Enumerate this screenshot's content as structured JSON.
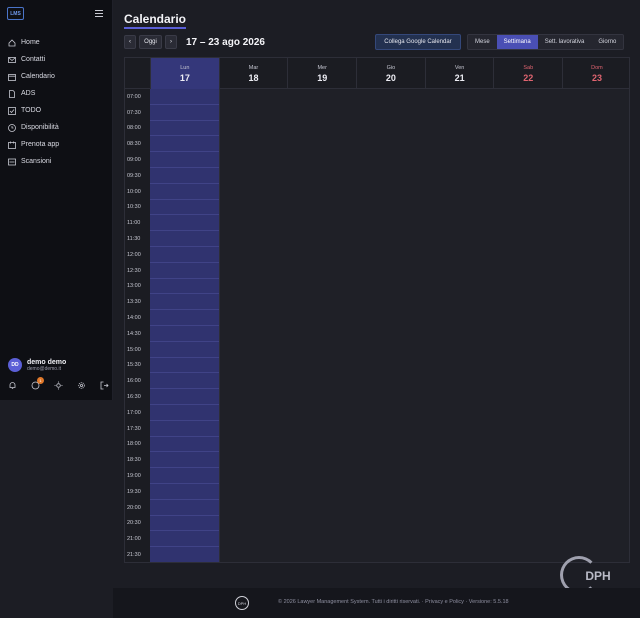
{
  "app": {
    "logo_text": "LMS"
  },
  "sidebar": {
    "items": [
      {
        "label": "Home",
        "icon": "home-icon"
      },
      {
        "label": "Contatti",
        "icon": "mail-icon"
      },
      {
        "label": "Calendario",
        "icon": "calendar-icon"
      },
      {
        "label": "ADS",
        "icon": "file-icon"
      },
      {
        "label": "TODO",
        "icon": "checkbox-icon"
      },
      {
        "label": "Disponibilità",
        "icon": "clock-icon"
      },
      {
        "label": "Prenota app",
        "icon": "calendar-book-icon"
      },
      {
        "label": "Scansioni",
        "icon": "scan-icon"
      }
    ],
    "user": {
      "initials": "DD",
      "name": "demo demo",
      "email": "demo@demo.it"
    },
    "notification_badge": "1"
  },
  "header": {
    "title": "Calendario",
    "prev": "‹",
    "today": "Oggi",
    "next": "›",
    "range": "17 – 23 ago 2026",
    "google_button": "Collega Google Calendar",
    "views": [
      "Mese",
      "Settimana",
      "Sett. lavorativa",
      "Giorno"
    ],
    "active_view": "Settimana"
  },
  "calendar": {
    "days": [
      {
        "name": "Lun",
        "date": "17"
      },
      {
        "name": "Mar",
        "date": "18"
      },
      {
        "name": "Mer",
        "date": "19"
      },
      {
        "name": "Gio",
        "date": "20"
      },
      {
        "name": "Ven",
        "date": "21"
      },
      {
        "name": "Sab",
        "date": "22"
      },
      {
        "name": "Dom",
        "date": "23"
      }
    ],
    "times": [
      "07:00",
      "07:30",
      "08:00",
      "08:30",
      "09:00",
      "09:30",
      "10:00",
      "10:30",
      "11:00",
      "11:30",
      "12:00",
      "12:30",
      "13:00",
      "13:30",
      "14:00",
      "14:30",
      "15:00",
      "15:30",
      "16:00",
      "16:30",
      "17:00",
      "17:30",
      "18:00",
      "18:30",
      "19:00",
      "19:30",
      "20:00",
      "20:30",
      "21:00",
      "21:30"
    ]
  },
  "footer": {
    "logo_text": "DPH",
    "text": "© 2026 Lawyer Management System. Tutti i diritti riservati. · Privacy e Policy · Versione: 5.5.18"
  },
  "watermark": {
    "text": "DPH"
  },
  "colors": {
    "accent": "#5b5fd6",
    "weekend": "#e06470",
    "today_column": "#30336f"
  }
}
